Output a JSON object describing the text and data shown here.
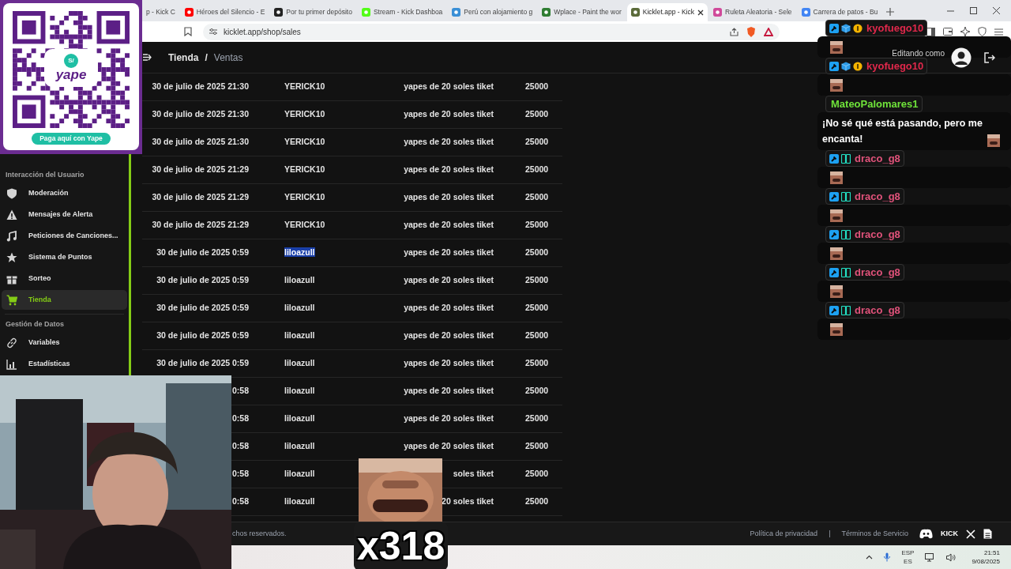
{
  "browser": {
    "tabs": [
      {
        "label": "p - Kick C",
        "selected": false
      },
      {
        "label": "Héroes del Silencio - E",
        "selected": false,
        "color": "#ff0000"
      },
      {
        "label": "Por tu primer depósito",
        "selected": false,
        "color": "#222222"
      },
      {
        "label": "Stream - Kick Dashboa",
        "selected": false,
        "color": "#53fc18"
      },
      {
        "label": "Perú con alojamiento g",
        "selected": false,
        "color": "#3a8fd6"
      },
      {
        "label": "Wplace - Paint the wor",
        "selected": false,
        "color": "#2f7d32"
      },
      {
        "label": "Kicklet.app - Kick",
        "selected": true,
        "color": "#5b6b3a"
      },
      {
        "label": "Ruleta Aleatoria - Sele",
        "selected": false,
        "color": "#d04a9a"
      },
      {
        "label": "Carrera de patos - Bu",
        "selected": false,
        "color": "#4285f4"
      }
    ],
    "url": "kicklet.app/shop/sales"
  },
  "qr_overlay": {
    "currency": "S/",
    "logo": "yape",
    "button": "Paga aquí con Yape"
  },
  "breadcrumb": {
    "section": "Tienda",
    "separator": "/",
    "page": "Ventas"
  },
  "account": {
    "label": "Editando como"
  },
  "sidebar": {
    "groups": [
      {
        "heading": "Interacción del Usuario",
        "items": [
          {
            "label": "Moderación",
            "kind": "shield",
            "selected": false
          },
          {
            "label": "Mensajes de Alerta",
            "kind": "alert",
            "selected": false
          },
          {
            "label": "Peticiones de Canciones...",
            "kind": "music",
            "selected": false
          },
          {
            "label": "Sistema de Puntos",
            "kind": "star",
            "selected": false
          },
          {
            "label": "Sorteo",
            "kind": "gift",
            "selected": false
          },
          {
            "label": "Tienda",
            "kind": "cart",
            "selected": true
          }
        ]
      },
      {
        "heading": "Gestión de Datos",
        "items": [
          {
            "label": "Variables",
            "kind": "link",
            "selected": false
          },
          {
            "label": "Estadísticas",
            "kind": "chart",
            "selected": false
          }
        ]
      }
    ]
  },
  "sales": {
    "rows": [
      {
        "date": "30 de julio de 2025 21:30",
        "user": "YERICK10",
        "user_selected": false,
        "product": "yapes de 20 soles tiket",
        "price": "25000"
      },
      {
        "date": "30 de julio de 2025 21:30",
        "user": "YERICK10",
        "user_selected": false,
        "product": "yapes de 20 soles tiket",
        "price": "25000"
      },
      {
        "date": "30 de julio de 2025 21:30",
        "user": "YERICK10",
        "user_selected": false,
        "product": "yapes de 20 soles tiket",
        "price": "25000"
      },
      {
        "date": "30 de julio de 2025 21:29",
        "user": "YERICK10",
        "user_selected": false,
        "product": "yapes de 20 soles tiket",
        "price": "25000"
      },
      {
        "date": "30 de julio de 2025 21:29",
        "user": "YERICK10",
        "user_selected": false,
        "product": "yapes de 20 soles tiket",
        "price": "25000"
      },
      {
        "date": "30 de julio de 2025 21:29",
        "user": "YERICK10",
        "user_selected": false,
        "product": "yapes de 20 soles tiket",
        "price": "25000"
      },
      {
        "date": "30 de julio de 2025 0:59",
        "user": "liloazull",
        "user_selected": true,
        "product": "yapes de 20 soles tiket",
        "price": "25000"
      },
      {
        "date": "30 de julio de 2025 0:59",
        "user": "liloazull",
        "user_selected": false,
        "product": "yapes de 20 soles tiket",
        "price": "25000"
      },
      {
        "date": "30 de julio de 2025 0:59",
        "user": "liloazull",
        "user_selected": false,
        "product": "yapes de 20 soles tiket",
        "price": "25000"
      },
      {
        "date": "30 de julio de 2025 0:59",
        "user": "liloazull",
        "user_selected": false,
        "product": "yapes de 20 soles tiket",
        "price": "25000"
      },
      {
        "date": "30 de julio de 2025 0:59",
        "user": "liloazull",
        "user_selected": false,
        "product": "yapes de 20 soles tiket",
        "price": "25000"
      },
      {
        "date": "0:58",
        "user": "liloazull",
        "user_selected": false,
        "product": "yapes de 20 soles tiket",
        "price": "25000"
      },
      {
        "date": "0:58",
        "user": "liloazull",
        "user_selected": false,
        "product": "yapes de 20 soles tiket",
        "price": "25000"
      },
      {
        "date": "0:58",
        "user": "liloazull",
        "user_selected": false,
        "product": "yapes de 20 soles tiket",
        "price": "25000"
      },
      {
        "date": "0:58",
        "user": "liloazull",
        "user_selected": false,
        "product": "soles tiket",
        "price": "25000"
      },
      {
        "date": "0:58",
        "user": "liloazull",
        "user_selected": false,
        "product": "20 soles tiket",
        "price": "25000"
      }
    ]
  },
  "footer": {
    "copyright": "chos reservados.",
    "links": [
      "Política de privacidad",
      "Términos de Servicio"
    ],
    "separator": "|",
    "kick_logo": "KICK"
  },
  "taskbar": {
    "language": "ESP",
    "layout": "ES",
    "time": "21:51",
    "date": "9/08/2025"
  },
  "chat": {
    "messages": [
      {
        "user": "kyofuego10",
        "color": "#e0284b",
        "badges": [
          {
            "kind": "moderator"
          },
          {
            "kind": "cube"
          },
          {
            "kind": "coin"
          }
        ],
        "emote": true
      },
      {
        "user": "kyofuego10",
        "color": "#e0284b",
        "badges": [
          {
            "kind": "moderator"
          },
          {
            "kind": "cube"
          },
          {
            "kind": "coin"
          }
        ],
        "emote": true
      },
      {
        "user": "MateoPalomares1",
        "color": "#6fe33a",
        "text": "¡No sé qué está pasando, pero me encanta!",
        "emote": true
      },
      {
        "user": "draco_g8",
        "color": "#e0527a",
        "badges": [
          {
            "kind": "moderator"
          },
          {
            "kind": "og"
          }
        ],
        "emote": true
      },
      {
        "user": "draco_g8",
        "color": "#e0527a",
        "badges": [
          {
            "kind": "moderator"
          },
          {
            "kind": "og"
          }
        ],
        "emote": true
      },
      {
        "user": "draco_g8",
        "color": "#e0527a",
        "badges": [
          {
            "kind": "moderator"
          },
          {
            "kind": "og"
          }
        ],
        "emote": true
      },
      {
        "user": "draco_g8",
        "color": "#e0527a",
        "badges": [
          {
            "kind": "moderator"
          },
          {
            "kind": "og"
          }
        ],
        "emote": true
      },
      {
        "user": "draco_g8",
        "color": "#e0527a",
        "badges": [
          {
            "kind": "moderator"
          },
          {
            "kind": "og"
          }
        ],
        "emote": true
      }
    ]
  },
  "meme_overlay": {
    "count": "x318"
  }
}
